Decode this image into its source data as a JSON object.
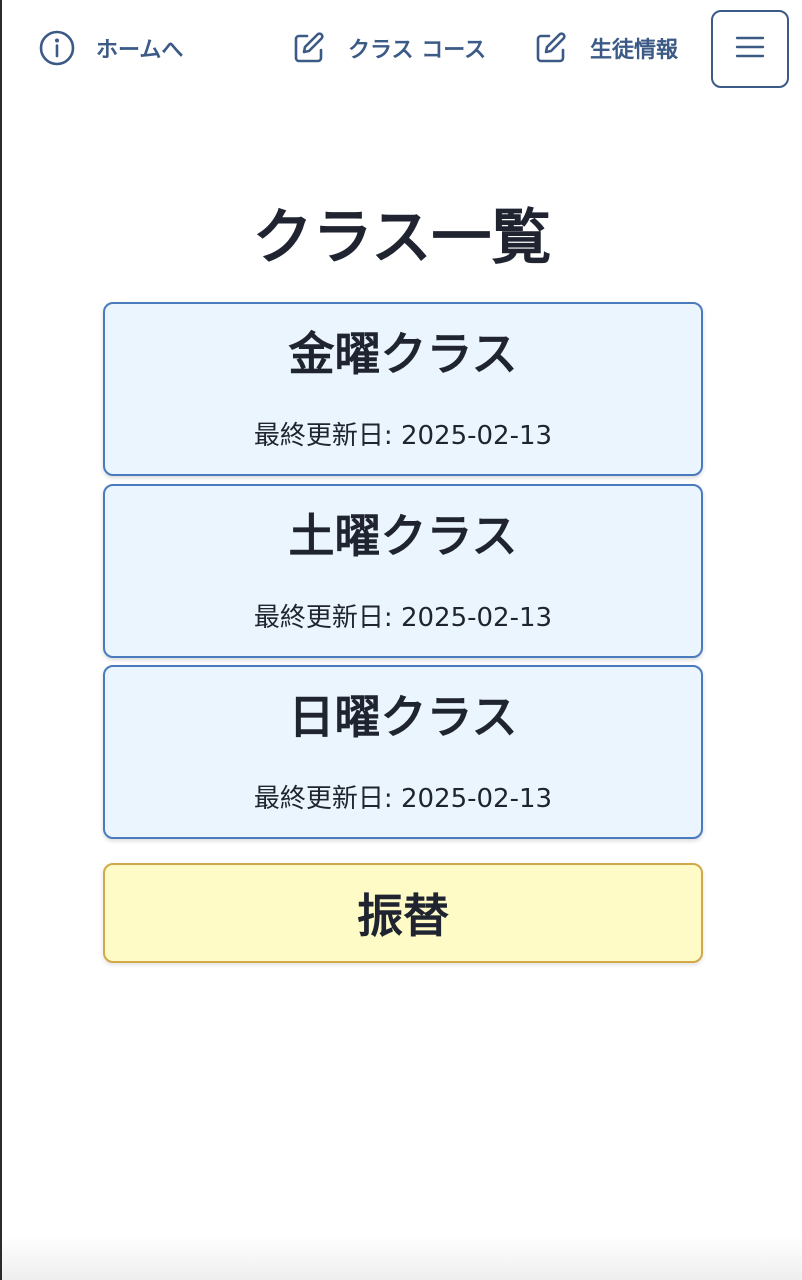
{
  "nav": {
    "home": {
      "label": "ホームへ",
      "icon": "info-circle-icon"
    },
    "classes": {
      "label": "クラス コース",
      "icon": "edit-icon"
    },
    "students": {
      "label": "生徒情報",
      "icon": "edit-icon"
    },
    "menu_icon": "hamburger-icon"
  },
  "page": {
    "title": "クラス一覧"
  },
  "classes": [
    {
      "name": "金曜クラス",
      "updated_label": "最終更新日: ",
      "updated_date": "2025-02-13"
    },
    {
      "name": "土曜クラス",
      "updated_label": "最終更新日: ",
      "updated_date": "2025-02-13"
    },
    {
      "name": "日曜クラス",
      "updated_label": "最終更新日: ",
      "updated_date": "2025-02-13"
    }
  ],
  "transfer": {
    "label": "振替"
  },
  "colors": {
    "nav_accent": "#3c5a86",
    "card_bg": "#eaf5fd",
    "card_border": "#4a7bbf",
    "transfer_bg": "#fefbc6",
    "transfer_border": "#d2a94a"
  }
}
